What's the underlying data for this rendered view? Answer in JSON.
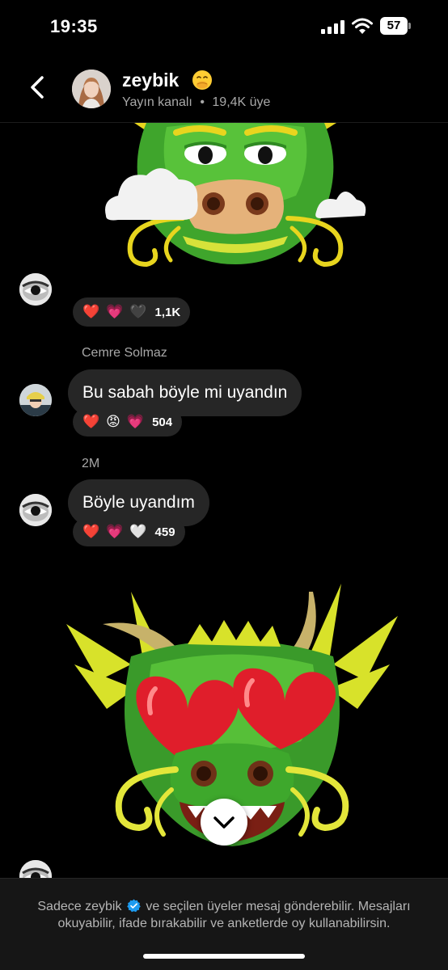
{
  "status_bar": {
    "time": "19:35",
    "battery": "57"
  },
  "header": {
    "back_icon": "chevron-left-icon",
    "channel_name": "zeybik",
    "channel_emoji": "face-with-hand-over-mouth-emoji",
    "subtitle_type": "Yayın kanalı",
    "subtitle_separator": "•",
    "subtitle_members": "19,4K üye"
  },
  "messages": [
    {
      "type": "sticker",
      "sticker": "dragon-face-emoji",
      "reactions": [
        "❤️",
        "💗",
        "🖤"
      ],
      "reaction_count": "1,1K"
    },
    {
      "type": "text",
      "sender": "Cemre Solmaz",
      "text": "Bu sabah böyle mi uyandın",
      "reactions": [
        "❤️",
        "😡",
        "💗"
      ],
      "reaction_count": "504"
    },
    {
      "type": "text",
      "sender": "2M",
      "text": "Böyle uyandım",
      "reactions": [
        "❤️",
        "💗",
        "🤍"
      ],
      "reaction_count": "459"
    },
    {
      "type": "sticker",
      "sticker": "dragon-heart-eyes-emoji"
    }
  ],
  "footer": {
    "line_part1": "Sadece zeybik",
    "line_part2": "ve seçilen üyeler mesaj gönderebilir. Mesajları okuyabilir, ifade bırakabilir ve anketlerde oy kullanabilirsin."
  },
  "colors": {
    "background": "#000000",
    "bubble": "#262626",
    "muted_text": "#a8a8a8",
    "verified": "#1d9bf0"
  }
}
